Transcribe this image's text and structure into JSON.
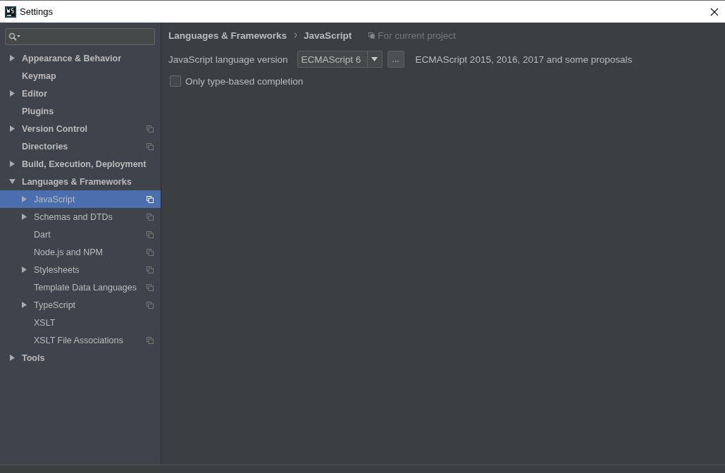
{
  "window": {
    "title": "Settings"
  },
  "sidebar": {
    "items": [
      {
        "label": "Appearance & Behavior",
        "kind": "group",
        "expanded": false,
        "project_scoped": false,
        "selected": false
      },
      {
        "label": "Keymap",
        "kind": "leaf",
        "project_scoped": false,
        "selected": false
      },
      {
        "label": "Editor",
        "kind": "group",
        "expanded": false,
        "project_scoped": false,
        "selected": false
      },
      {
        "label": "Plugins",
        "kind": "leaf",
        "project_scoped": false,
        "selected": false
      },
      {
        "label": "Version Control",
        "kind": "group",
        "expanded": false,
        "project_scoped": true,
        "selected": false
      },
      {
        "label": "Directories",
        "kind": "leaf",
        "project_scoped": true,
        "selected": false
      },
      {
        "label": "Build, Execution, Deployment",
        "kind": "group",
        "expanded": false,
        "project_scoped": false,
        "selected": false
      },
      {
        "label": "Languages & Frameworks",
        "kind": "group",
        "expanded": true,
        "project_scoped": false,
        "selected": false,
        "children": [
          {
            "label": "JavaScript",
            "kind": "group",
            "expanded": false,
            "project_scoped": true,
            "selected": true
          },
          {
            "label": "Schemas and DTDs",
            "kind": "group",
            "expanded": false,
            "project_scoped": true,
            "selected": false
          },
          {
            "label": "Dart",
            "kind": "leaf",
            "project_scoped": true,
            "selected": false
          },
          {
            "label": "Node.js and NPM",
            "kind": "leaf",
            "project_scoped": true,
            "selected": false
          },
          {
            "label": "Stylesheets",
            "kind": "group",
            "expanded": false,
            "project_scoped": true,
            "selected": false
          },
          {
            "label": "Template Data Languages",
            "kind": "leaf",
            "project_scoped": true,
            "selected": false
          },
          {
            "label": "TypeScript",
            "kind": "group",
            "expanded": false,
            "project_scoped": true,
            "selected": false
          },
          {
            "label": "XSLT",
            "kind": "leaf",
            "project_scoped": false,
            "selected": false
          },
          {
            "label": "XSLT File Associations",
            "kind": "leaf",
            "project_scoped": true,
            "selected": false
          }
        ]
      },
      {
        "label": "Tools",
        "kind": "group",
        "expanded": false,
        "project_scoped": false,
        "selected": false
      }
    ]
  },
  "content": {
    "breadcrumb": [
      "Languages & Frameworks",
      "JavaScript"
    ],
    "scope": "For current project",
    "version": {
      "label": "JavaScript language version",
      "value": "ECMAScript 6",
      "more": "...",
      "description": "ECMAScript 2015, 2016, 2017 and some proposals"
    },
    "option": {
      "label": "Only type-based completion",
      "checked": false
    }
  }
}
